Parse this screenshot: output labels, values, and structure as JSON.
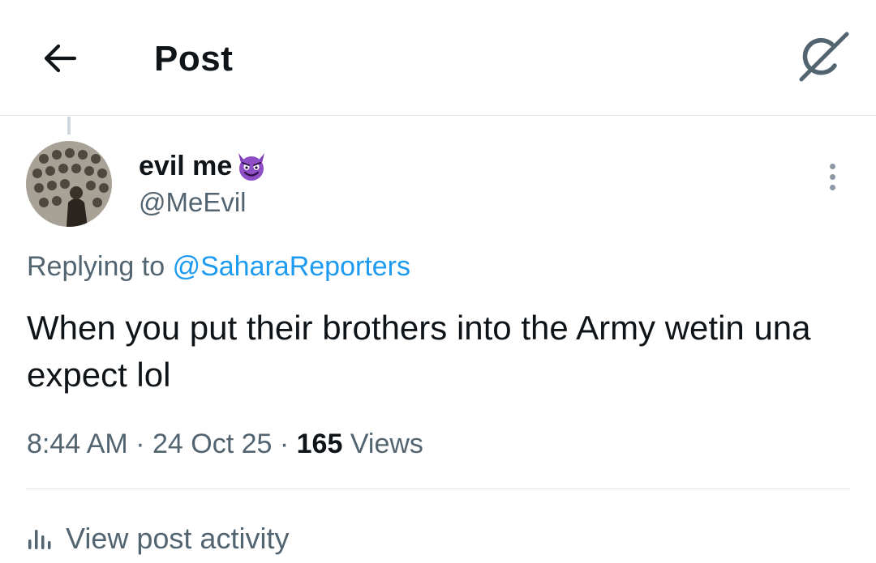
{
  "header": {
    "title": "Post",
    "back_icon": "arrow-left-icon",
    "grok_icon": "grok-icon"
  },
  "post": {
    "author": {
      "display_name": "evil me",
      "emoji": "smiling-face-with-horns-emoji",
      "handle": "@MeEvil"
    },
    "replying_prefix": "Replying to",
    "replying_mention": "@SaharaReporters",
    "text": "When you put their brothers into the Army wetin una expect lol",
    "time": "8:44 AM",
    "separator": "·",
    "date": "24 Oct 25",
    "views_count": "165",
    "views_label": "Views"
  },
  "footer": {
    "activity_label": "View post activity",
    "activity_icon": "bar-chart-icon"
  },
  "colors": {
    "text_primary": "#0f1419",
    "text_secondary": "#536471",
    "link": "#1d9bf0",
    "divider": "#e6e9eb"
  }
}
